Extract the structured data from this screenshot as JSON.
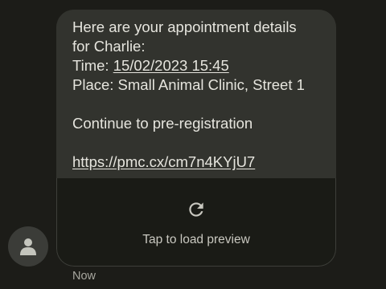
{
  "message": {
    "line1": "Here are your appointment details",
    "line2": "for Charlie:",
    "time_label": "Time: ",
    "time_value": "15/02/2023 15:45",
    "place": "Place: Small Animal Clinic, Street 1",
    "cta": "Continue to pre-registration",
    "link": "https://pmc.cx/cm7n4KYjU7"
  },
  "preview": {
    "icon": "refresh-icon",
    "label": "Tap to load preview"
  },
  "timestamp": "Now",
  "avatar_icon": "person-icon"
}
